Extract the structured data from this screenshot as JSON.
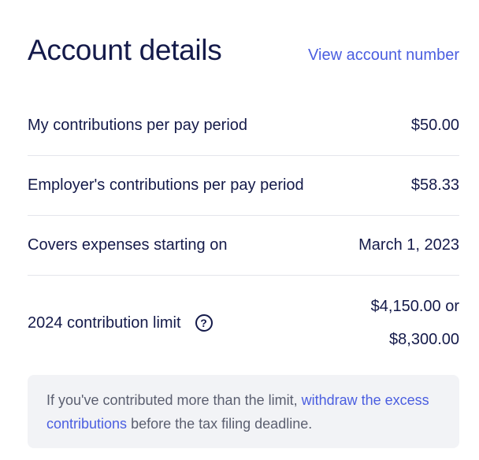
{
  "header": {
    "title": "Account details",
    "view_link": "View account number"
  },
  "rows": [
    {
      "label": "My contributions per pay period",
      "value": "$50.00"
    },
    {
      "label": "Employer's contributions per pay period",
      "value": "$58.33"
    },
    {
      "label": "Covers expenses starting on",
      "value": "March 1, 2023"
    },
    {
      "label": "2024 contribution limit",
      "value_line1": "$4,150.00 or",
      "value_line2": "$8,300.00",
      "help_icon": "question-circle-icon"
    }
  ],
  "note": {
    "prefix": "If you've contributed more than the limit, ",
    "link": "withdraw the excess contributions",
    "suffix": " before the tax filing deadline."
  },
  "colors": {
    "text": "#141a4a",
    "link": "#4a5ee0",
    "note_bg": "#f2f3f6",
    "note_text": "#5b5f70"
  }
}
